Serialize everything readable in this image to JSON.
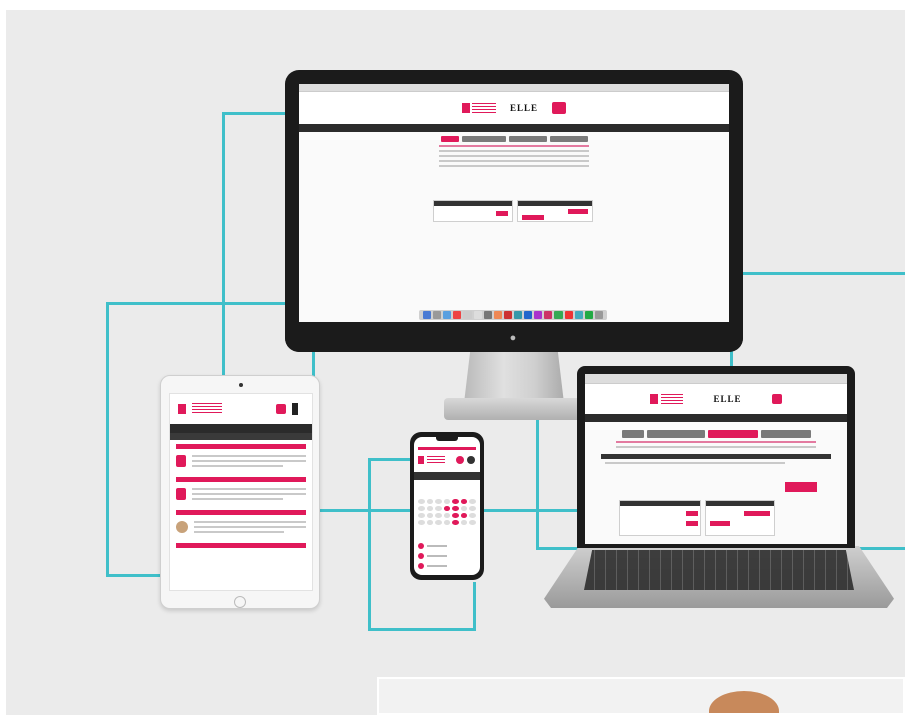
{
  "title": "",
  "colors": {
    "brand": "#e0195a",
    "connector": "#3fbfc9",
    "background": "#ebebeb",
    "device_dark": "#1b1b1b"
  },
  "devices": {
    "desktop": {
      "brand": "ELLE",
      "logo": "apple-logo"
    },
    "tablet": {},
    "phone": {},
    "laptop": {
      "brand": "ELLE"
    }
  }
}
